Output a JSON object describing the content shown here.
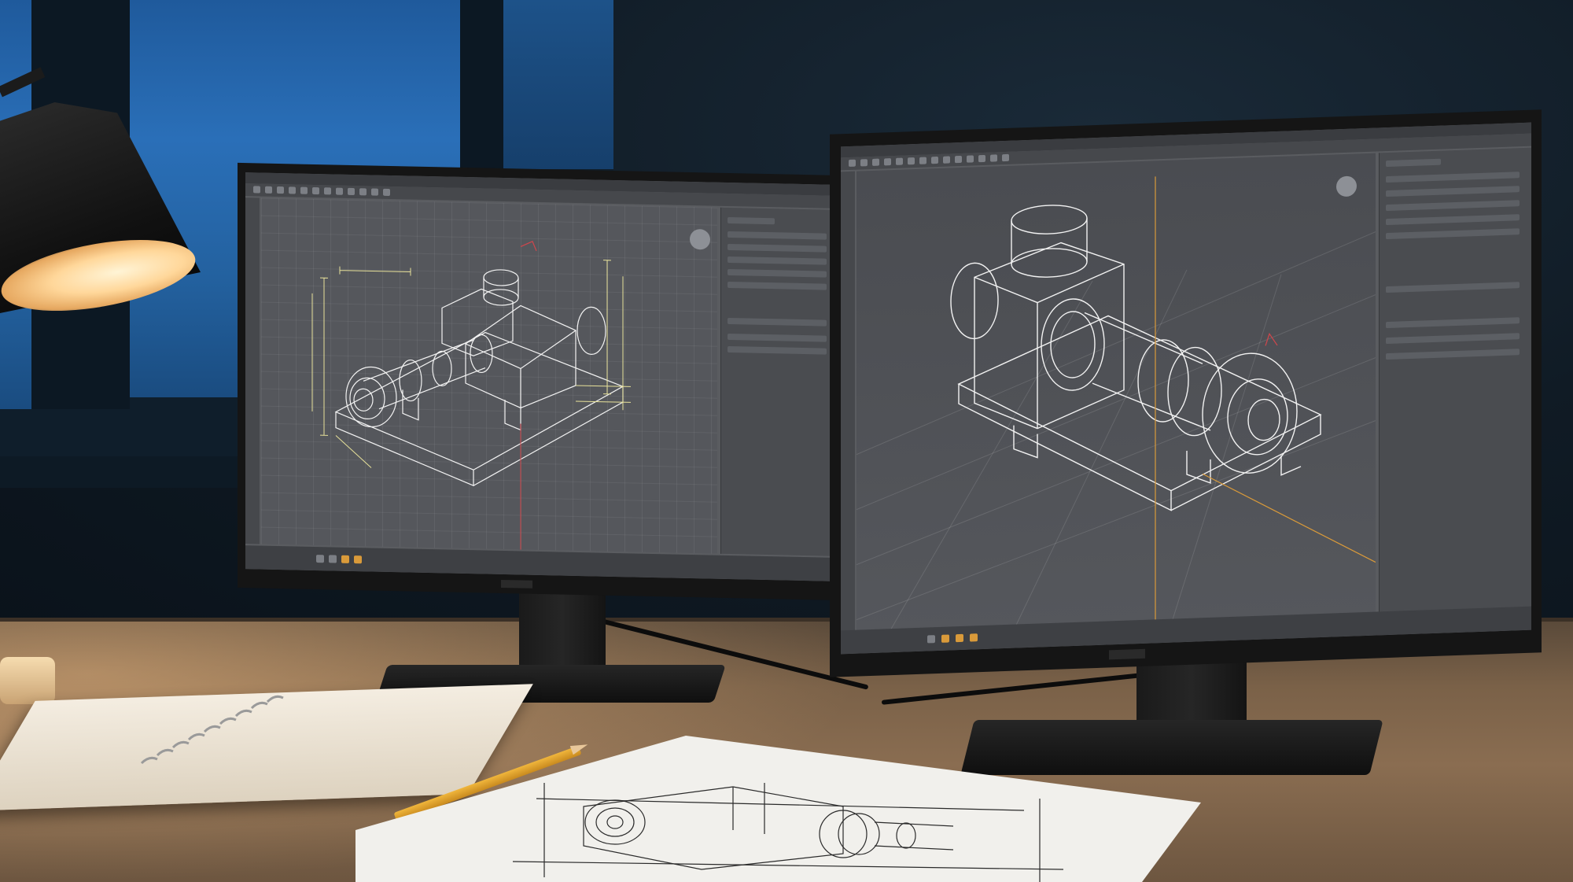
{
  "scene": {
    "description_tag": "",
    "colors": {
      "window_blue": "#2a6fb8",
      "cad_background": "#55575c",
      "wireframe_white": "#f2f2f2",
      "dimension_yellow": "#e8e29a",
      "axis_red": "#d0464c",
      "axis_orange": "#d99a3a",
      "desk_wood": "#7a6148",
      "lamp_glow": "#ffd79a"
    }
  },
  "monitor_left": {
    "content": "cad-isometric-pump-wireframe",
    "icons": [
      "nav-cube-icon",
      "toolbar-icons"
    ]
  },
  "monitor_right": {
    "content": "cad-perspective-pump-wireframe",
    "icons": [
      "nav-cube-icon",
      "toolbar-icons"
    ]
  },
  "paper": {
    "content": "printed-technical-drawing"
  }
}
